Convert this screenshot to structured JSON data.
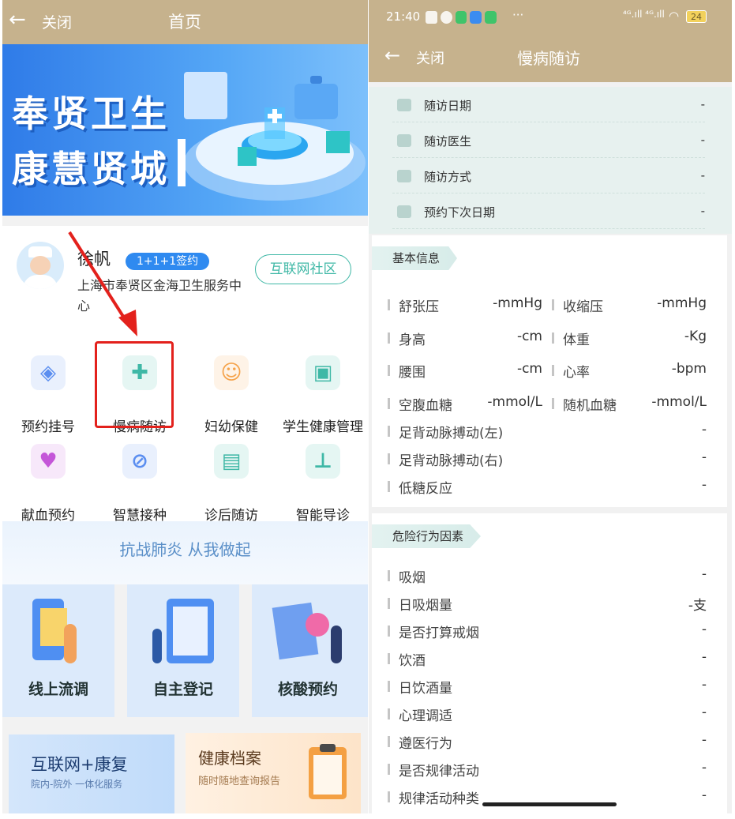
{
  "left": {
    "header": {
      "back_label": "关闭",
      "title": "首页"
    },
    "banner": {
      "line1": "奉贤卫生",
      "line2": "康慧贤城"
    },
    "doctor": {
      "name": "徐帆",
      "badge": "1+1+1签约",
      "org_line1": "上海市奉贤区金海卫生服务中",
      "org_line2": "心",
      "community_button": "互联网社区"
    },
    "services": [
      {
        "label": "预约挂号",
        "icon": "tag-icon",
        "color": "#5b8ef0"
      },
      {
        "label": "慢病随访",
        "icon": "medical-kit-icon",
        "color": "#3fb8a6"
      },
      {
        "label": "妇幼保健",
        "icon": "baby-face-icon",
        "color": "#f5a34b"
      },
      {
        "label": "学生健康管理",
        "icon": "graduation-cap-icon",
        "color": "#3fb8a6"
      },
      {
        "label": "献血预约",
        "icon": "blood-drop-icon",
        "color": "#c456d8"
      },
      {
        "label": "智慧接种",
        "icon": "vaccine-icon",
        "color": "#5b8ef0"
      },
      {
        "label": "诊后随访",
        "icon": "followup-card-icon",
        "color": "#3fb8a6"
      },
      {
        "label": "智能导诊",
        "icon": "signpost-icon",
        "color": "#3fb8a6"
      }
    ],
    "slogan": "抗战肺炎 从我做起",
    "quick_cards": [
      "线上流调",
      "自主登记",
      "核酸预约"
    ],
    "rehab": {
      "title": "互联网+康复",
      "subtitle": "院内-院外 一体化服务"
    },
    "archive": {
      "title": "健康档案",
      "subtitle": "随时随地查询报告"
    }
  },
  "right": {
    "status_bar": {
      "time": "21:40",
      "more": "···",
      "signal": "⁴ᴳ.ıll ⁴ᴳ.ıll",
      "battery": "24"
    },
    "header": {
      "back_label": "关闭",
      "title": "慢病随访"
    },
    "visit_info": [
      {
        "label": "随访日期",
        "value": "-"
      },
      {
        "label": "随访医生",
        "value": "-"
      },
      {
        "label": "随访方式",
        "value": "-"
      },
      {
        "label": "预约下次日期",
        "value": "-"
      }
    ],
    "basic_info": {
      "title": "基本信息",
      "pairs": [
        [
          {
            "label": "舒张压",
            "value": "-mmHg"
          },
          {
            "label": "收缩压",
            "value": "-mmHg"
          }
        ],
        [
          {
            "label": "身高",
            "value": "-cm"
          },
          {
            "label": "体重",
            "value": "-Kg"
          }
        ],
        [
          {
            "label": "腰围",
            "value": "-cm"
          },
          {
            "label": "心率",
            "value": "-bpm"
          }
        ],
        [
          {
            "label": "空腹血糖",
            "value": "-mmol/L"
          },
          {
            "label": "随机血糖",
            "value": "-mmol/L"
          }
        ]
      ],
      "singles": [
        {
          "label": "足背动脉搏动(左)",
          "value": "-"
        },
        {
          "label": "足背动脉搏动(右)",
          "value": "-"
        },
        {
          "label": "低糖反应",
          "value": "-"
        }
      ]
    },
    "risk": {
      "title": "危险行为因素",
      "items": [
        {
          "label": "吸烟",
          "value": "-"
        },
        {
          "label": "日吸烟量",
          "value": "-支"
        },
        {
          "label": "是否打算戒烟",
          "value": "-"
        },
        {
          "label": "饮酒",
          "value": "-"
        },
        {
          "label": "日饮酒量",
          "value": "-"
        },
        {
          "label": "心理调适",
          "value": "-"
        },
        {
          "label": "遵医行为",
          "value": "-"
        },
        {
          "label": "是否规律活动",
          "value": "-"
        },
        {
          "label": "规律活动种类",
          "value": "-"
        }
      ]
    }
  }
}
